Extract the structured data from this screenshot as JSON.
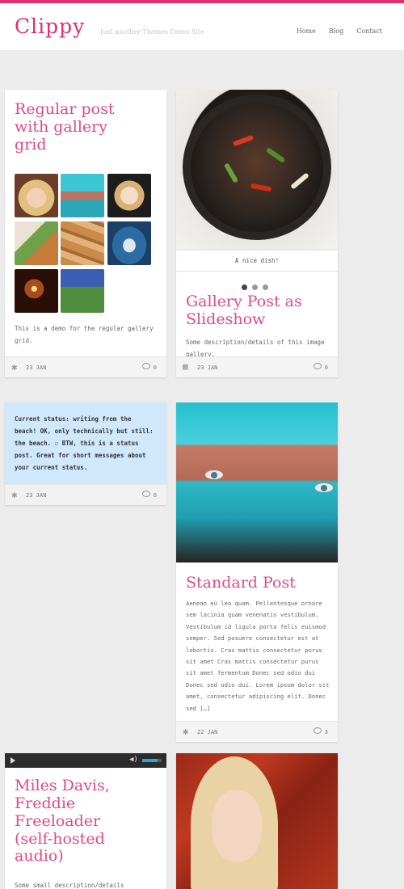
{
  "site": {
    "title": "Clippy",
    "tagline": "Just another Themes Demo Site",
    "accent": "#e0306f"
  },
  "nav": [
    "Home",
    "Blog",
    "Contact"
  ],
  "posts": {
    "gallery_grid": {
      "title": "Regular post with gallery grid",
      "excerpt": "This is a demo for the regular gallery grid.",
      "date": "23 JAN",
      "comments": "0",
      "meta_icon": "star-icon"
    },
    "slideshow": {
      "caption": "A nice dish!",
      "title": "Gallery Post as Slideshow",
      "excerpt": "Some description/details of this image gallery.",
      "date": "23 JAN",
      "comments": "0",
      "meta_icon": "gallery-icon",
      "slide_count": 3,
      "active_slide": 1
    },
    "status": {
      "text": "Current status: writing from the beach! OK, only technically but still: the beach. ☐ BTW, this is a status post. Great for short messages about your current status.",
      "date": "23 JAN",
      "comments": "0",
      "meta_icon": "star-icon",
      "background": "#cfe8fb"
    },
    "standard": {
      "title": "Standard Post",
      "excerpt": "Aenean eu leo quam. Pellentesque ornare sem lacinia quam venenatis vestibulum. Vestibulum id ligula porta felis euismod semper. Sed posuere consectetur est at lobortis. Cras mattis consectetur purus sit amet Cras mattis consectetur purus sit amet fermentum Donec sed odio dui Donec sed odio dui. Lorem ipsum dolor sit amet, consectetur adipiscing elit. Donec sed […]",
      "date": "22 JAN",
      "comments": "3",
      "meta_icon": "star-icon"
    },
    "audio": {
      "title": "Miles Davis, Freddie Freeloader (self-hosted audio)",
      "excerpt": "Some small description/details",
      "volume_level": 0.8
    }
  }
}
